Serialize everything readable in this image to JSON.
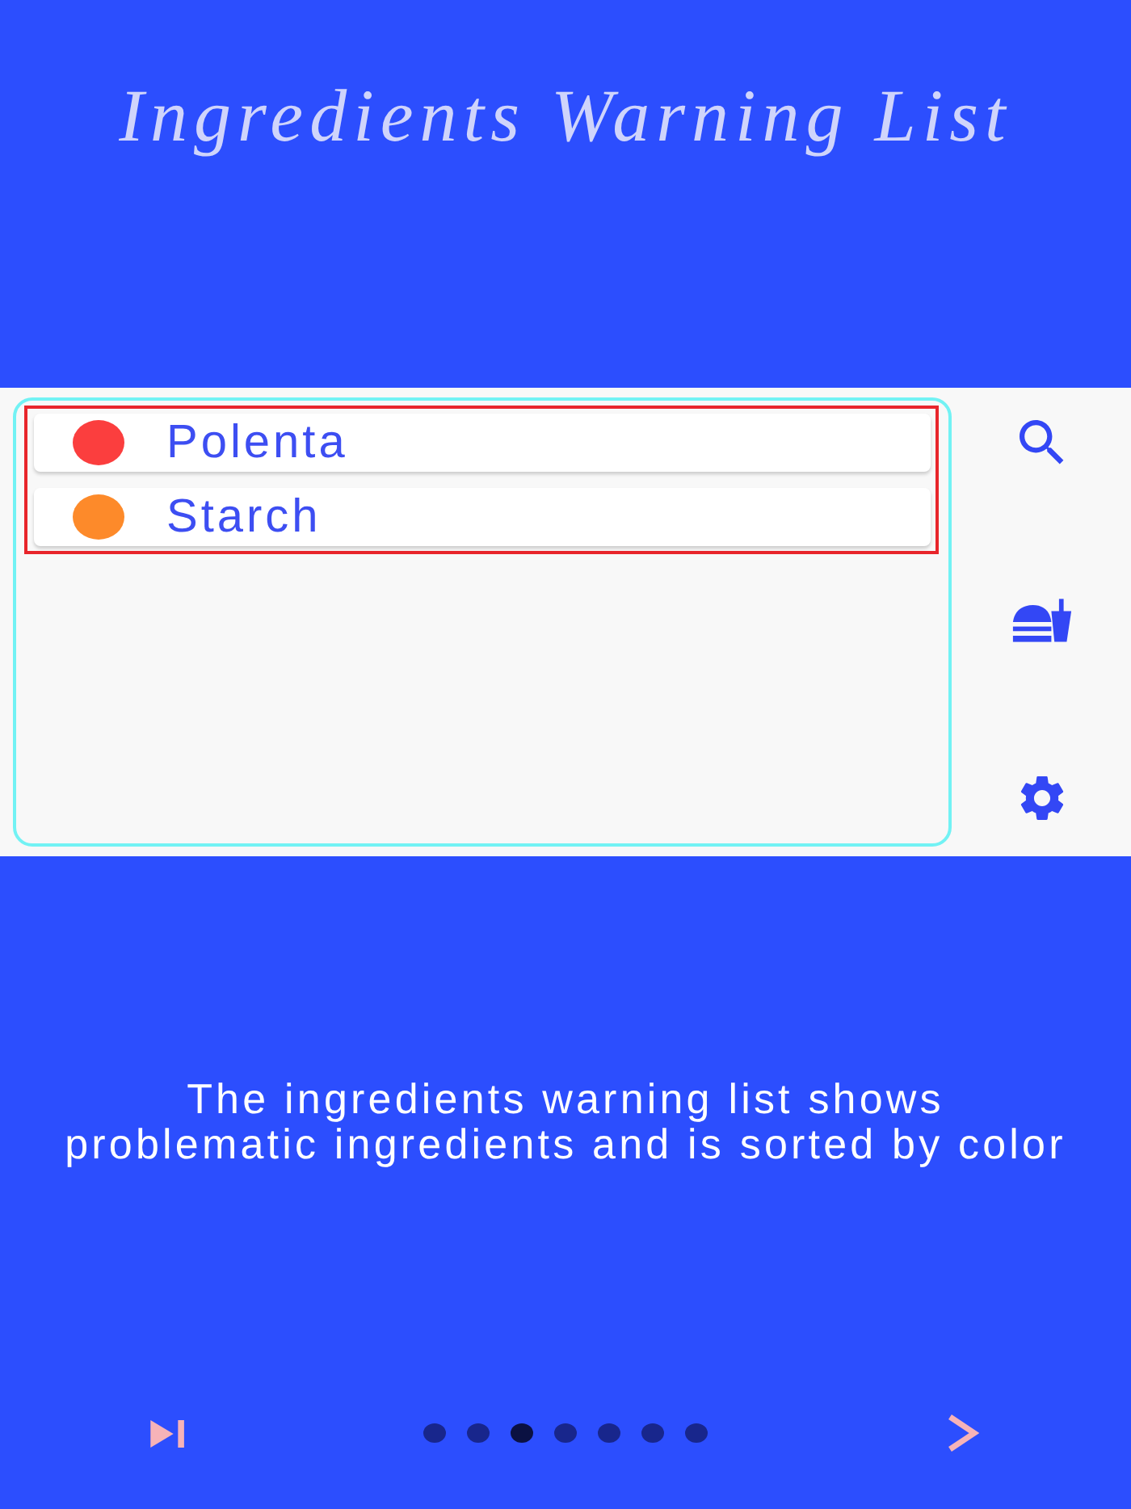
{
  "title": "Ingredients Warning List",
  "preview": {
    "items": [
      {
        "name": "Polenta",
        "color": "#fb3e3e"
      },
      {
        "name": "Starch",
        "color": "#fd8a2a"
      }
    ]
  },
  "caption": "The ingredients warning list shows problematic ingredients and is sorted by color",
  "pager": [
    {
      "selected": false
    },
    {
      "selected": false
    },
    {
      "selected": true
    },
    {
      "selected": false
    },
    {
      "selected": false
    },
    {
      "selected": false
    },
    {
      "selected": false
    }
  ]
}
